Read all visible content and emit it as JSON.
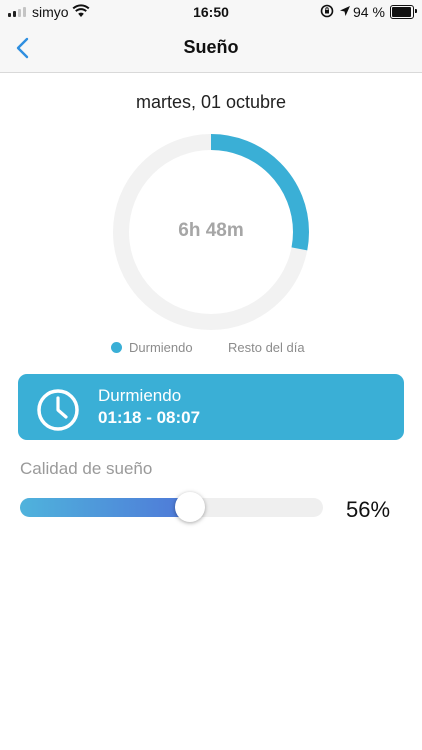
{
  "status_bar": {
    "carrier": "simyo",
    "time": "16:50",
    "battery": "94 %",
    "battery_level": 0.94
  },
  "nav": {
    "title": "Sueño",
    "back_icon": "chevron-left-icon"
  },
  "date": "martes, 01 octubre",
  "ring": {
    "center_text": "6h 48m",
    "sleep_fraction": 0.28,
    "sleep_color": "#3aafd6",
    "rest_color": "#f2f2f2"
  },
  "legend": {
    "sleeping": "Durmiendo",
    "rest": "Resto del día"
  },
  "sleep_card": {
    "title": "Durmiendo",
    "time_range": "01:18 - 08:07",
    "icon": "clock-icon",
    "color": "#3aafd6"
  },
  "quality": {
    "label": "Calidad de sueño",
    "value_text": "56%",
    "value": 0.56,
    "gradient_start": "#4fb3dc",
    "gradient_end": "#4f78d8"
  }
}
